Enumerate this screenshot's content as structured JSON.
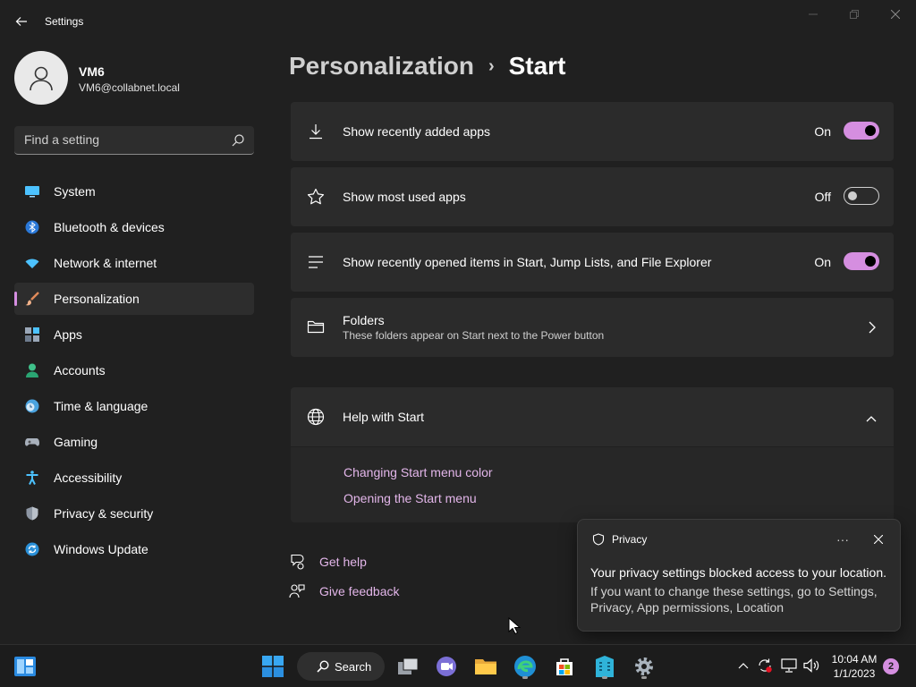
{
  "window": {
    "title": "Settings"
  },
  "profile": {
    "name": "VM6",
    "email": "VM6@collabnet.local"
  },
  "search": {
    "placeholder": "Find a setting"
  },
  "sidebar": {
    "items": [
      {
        "label": "System",
        "icon": "system-icon"
      },
      {
        "label": "Bluetooth & devices",
        "icon": "bluetooth-icon"
      },
      {
        "label": "Network & internet",
        "icon": "wifi-icon"
      },
      {
        "label": "Personalization",
        "icon": "brush-icon",
        "active": true
      },
      {
        "label": "Apps",
        "icon": "apps-icon"
      },
      {
        "label": "Accounts",
        "icon": "accounts-icon"
      },
      {
        "label": "Time & language",
        "icon": "clock-globe-icon"
      },
      {
        "label": "Gaming",
        "icon": "gamepad-icon"
      },
      {
        "label": "Accessibility",
        "icon": "accessibility-icon"
      },
      {
        "label": "Privacy & security",
        "icon": "shield-icon"
      },
      {
        "label": "Windows Update",
        "icon": "update-icon"
      }
    ]
  },
  "main": {
    "breadcrumb": {
      "parent": "Personalization",
      "separator": "›",
      "current": "Start"
    },
    "settings": [
      {
        "title": "Show recently added apps",
        "state": "On",
        "icon": "download-icon"
      },
      {
        "title": "Show most used apps",
        "state": "Off",
        "icon": "star-icon"
      },
      {
        "title": "Show recently opened items in Start, Jump Lists, and File Explorer",
        "state": "On",
        "icon": "list-icon"
      }
    ],
    "folders": {
      "title": "Folders",
      "subtitle": "These folders appear on Start next to the Power button",
      "icon": "folder-icon"
    },
    "help": {
      "title": "Help with Start",
      "links": [
        "Changing Start menu color",
        "Opening the Start menu"
      ]
    },
    "footer": {
      "get_help": "Get help",
      "give_feedback": "Give feedback"
    }
  },
  "toast": {
    "app": "Privacy",
    "more": "···",
    "title": "Your privacy settings blocked access to your location.",
    "body": "If you want to change these settings, go to Settings, Privacy, App permissions, Location"
  },
  "taskbar": {
    "search_label": "Search",
    "time": "10:04 AM",
    "date": "1/1/2023",
    "notification_count": "2"
  },
  "colors": {
    "accent": "#d58ee0",
    "link": "#e3b6ea",
    "background": "#202020",
    "card": "#2b2b2b"
  }
}
